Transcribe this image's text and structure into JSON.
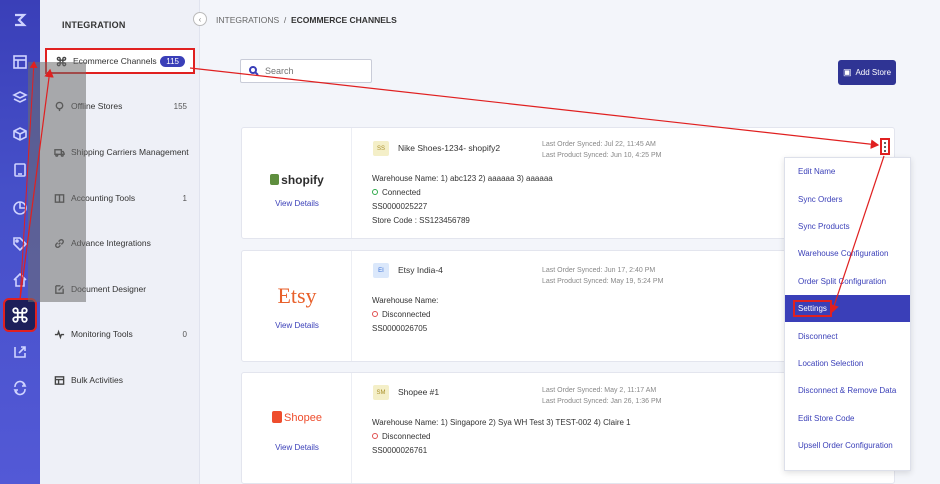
{
  "breadcrumb": {
    "root": "INTEGRATIONS",
    "sep": "/",
    "current": "ECOMMERCE CHANNELS"
  },
  "sidebar": {
    "title": "INTEGRATION",
    "items": [
      {
        "label": "Ecommerce Channels",
        "count": "115",
        "icon": "command-icon"
      },
      {
        "label": "Offline Stores",
        "count": "155",
        "icon": "store-icon"
      },
      {
        "label": "Shipping Carriers Management",
        "count": "",
        "icon": "truck-icon"
      },
      {
        "label": "Accounting Tools",
        "count": "1",
        "icon": "book-icon"
      },
      {
        "label": "Advance Integrations",
        "count": "",
        "icon": "link-icon"
      },
      {
        "label": "Document Designer",
        "count": "",
        "icon": "edit-icon"
      },
      {
        "label": "Monitoring Tools",
        "count": "0",
        "icon": "pulse-icon"
      },
      {
        "label": "Bulk Activities",
        "count": "",
        "icon": "grid-icon"
      }
    ]
  },
  "search": {
    "placeholder": "Search"
  },
  "toolbar": {
    "add_store_label": "Add Store"
  },
  "stores": [
    {
      "logo": "shopify",
      "view": "View Details",
      "badge": "SS",
      "name": "Nike Shoes-1234- shopify2",
      "order_sync": "Last Order Synced: Jul 22, 11:45 AM",
      "product_sync": "Last Product Synced: Jun 10, 4:25 PM",
      "warehouse": "Warehouse Name: 1) abc123 2) aaaaaa 3) aaaaaa",
      "status": "Connected",
      "code1": "SS0000025227",
      "code2": "Store Code : SS123456789"
    },
    {
      "logo": "Etsy",
      "view": "View Details",
      "badge": "EI",
      "name": "Etsy India-4",
      "order_sync": "Last Order Synced: Jun 17, 2:40 PM",
      "product_sync": "Last Product Synced: May 19, 5:24 PM",
      "warehouse": "Warehouse Name:",
      "status": "Disconnected",
      "code1": "SS0000026705",
      "code2": ""
    },
    {
      "logo": "Shopee",
      "view": "View Details",
      "badge": "SM",
      "name": "Shopee #1",
      "order_sync": "Last Order Synced: May 2, 11:17 AM",
      "product_sync": "Last Product Synced: Jan 26, 1:36 PM",
      "warehouse": "Warehouse Name: 1) Singapore 2) Sya WH Test 3) TEST-002 4) Claire 1",
      "status": "Disconnected",
      "code1": "SS0000026761",
      "code2": ""
    }
  ],
  "menu": [
    "Edit Name",
    "Sync Orders",
    "Sync Products",
    "Warehouse Configuration",
    "Order Split Configuration",
    "Settings",
    "Disconnect",
    "Location Selection",
    "Disconnect & Remove Data",
    "Edit Store Code",
    "Upsell Order Configuration"
  ],
  "colors": {
    "accent": "#3a3fb8",
    "highlight": "#e02020",
    "connected": "#2eaa4a",
    "disconnected": "#e05050"
  }
}
